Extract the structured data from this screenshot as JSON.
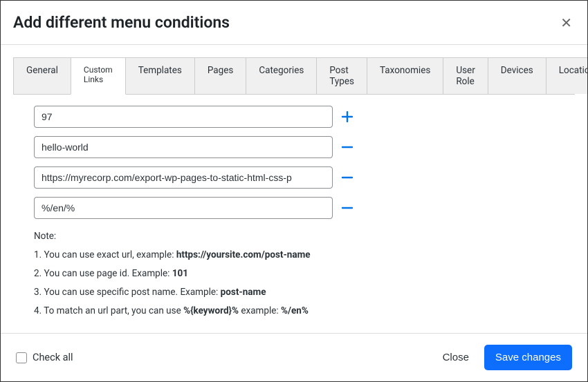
{
  "dialog": {
    "title": "Add different menu conditions",
    "close_button": "close"
  },
  "tabs": [
    {
      "label": "General",
      "active": false
    },
    {
      "label": "Custom Links",
      "active": true
    },
    {
      "label": "Templates",
      "active": false
    },
    {
      "label": "Pages",
      "active": false
    },
    {
      "label": "Categories",
      "active": false
    },
    {
      "label": "Post Types",
      "active": false
    },
    {
      "label": "Taxonomies",
      "active": false
    },
    {
      "label": "User Role",
      "active": false
    },
    {
      "label": "Devices",
      "active": false
    },
    {
      "label": "Locations",
      "active": false
    }
  ],
  "links": [
    {
      "value": "97",
      "action": "add"
    },
    {
      "value": "hello-world",
      "action": "remove"
    },
    {
      "value": "https://myrecorp.com/export-wp-pages-to-static-html-css-p",
      "action": "remove"
    },
    {
      "value": "%/en/%",
      "action": "remove"
    }
  ],
  "notes": {
    "heading": "Note:",
    "line1": {
      "prefix": "1. You can use exact url, example: ",
      "bold": "https://yoursite.com/post-name"
    },
    "line2": {
      "prefix": "2. You can use page id. Example: ",
      "bold": "101"
    },
    "line3": {
      "prefix": "3. You can use specific post name. Example: ",
      "bold": "post-name"
    },
    "line4": {
      "prefix": "4. To match an url part, you can use ",
      "bold1": "%{keyword}%",
      "mid": " example: ",
      "bold2": "%/en%"
    }
  },
  "footer": {
    "check_all_label": "Check all",
    "close_label": "Close",
    "save_label": "Save changes"
  }
}
